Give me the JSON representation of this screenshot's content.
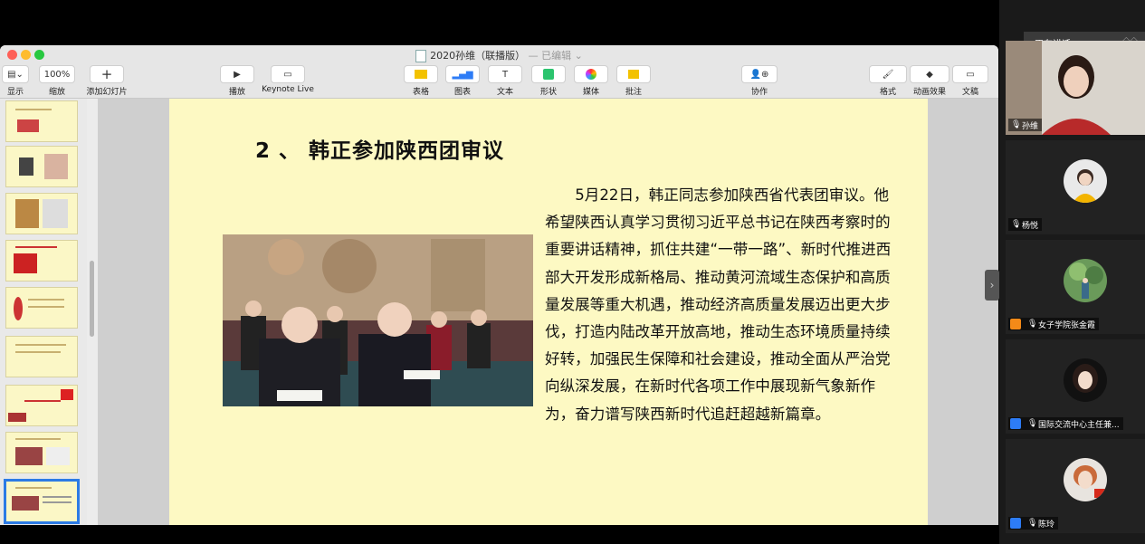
{
  "window": {
    "title": "2020孙维（联播版）",
    "status": "— 已编辑"
  },
  "toolbar": {
    "view": {
      "label": "显示"
    },
    "zoom": {
      "value": "100%",
      "label": "缩放"
    },
    "add_slide": {
      "label": "添加幻灯片"
    },
    "play": {
      "label": "播放"
    },
    "keynote_live": {
      "label": "Keynote Live"
    },
    "table": {
      "label": "表格"
    },
    "chart": {
      "label": "图表"
    },
    "text": {
      "label": "文本"
    },
    "shape": {
      "label": "形状"
    },
    "media": {
      "label": "媒体"
    },
    "comment": {
      "label": "批注"
    },
    "collaborate": {
      "label": "协作"
    },
    "format": {
      "label": "格式"
    },
    "animate": {
      "label": "动画效果"
    },
    "document": {
      "label": "文稿"
    }
  },
  "slide": {
    "title": "2 、 韩正参加陕西团审议",
    "body": "5月22日，韩正同志参加陕西省代表团审议。他希望陕西认真学习贯彻习近平总书记在陕西考察时的重要讲话精神，抓住共建“一带一路”、新时代推进西部大开发形成新格局、推动黄河流域生态保护和高质量发展等重大机遇，推动经济高质量发展迈出更大步伐，打造内陆改革开放高地，推动生态环境质量持续好转，加强民生保障和社会建设，推动全面从严治党向纵深发展，在新时代各项工作中展现新气象新作为，奋力谱写陕西新时代追赶超越新篇章。"
  },
  "meeting": {
    "speaking_label": "正在讲话:",
    "participants": [
      {
        "name": "孙维"
      },
      {
        "name": "杨悦"
      },
      {
        "name": "女子学院张金霞"
      },
      {
        "name": "国际交流中心主任兼..."
      },
      {
        "name": "陈玲"
      }
    ]
  },
  "colors": {
    "slide_bg": "#fdf9c3",
    "selection": "#2c7be5",
    "meeting_bg": "#1a1a1a"
  }
}
